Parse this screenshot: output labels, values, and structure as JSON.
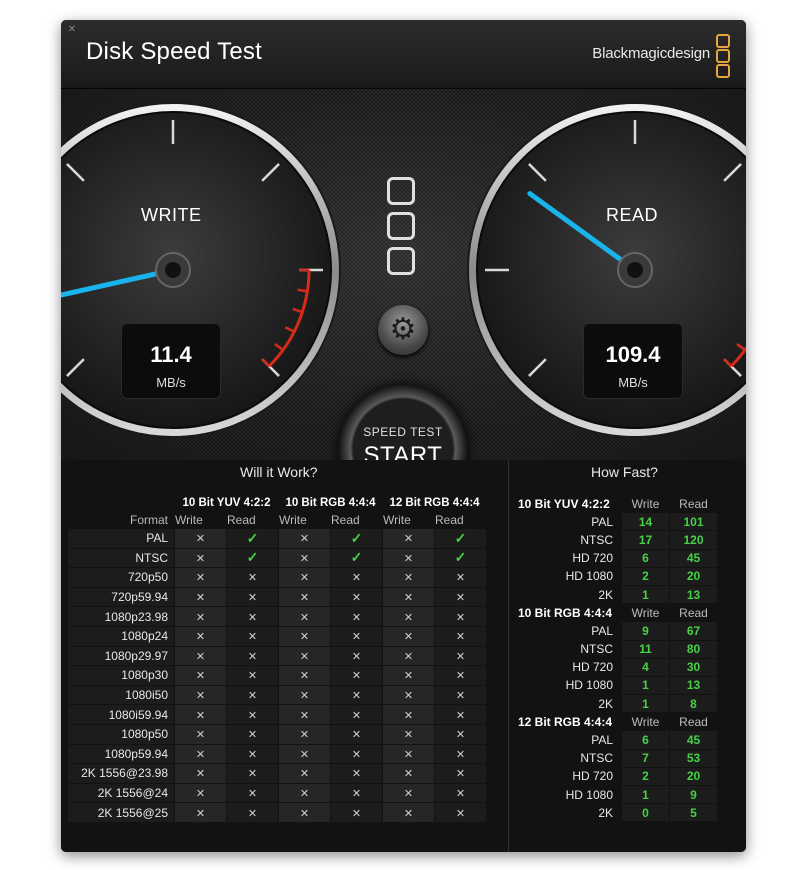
{
  "window": {
    "title": "Disk Speed Test",
    "brand": "Blackmagicdesign"
  },
  "gauges": {
    "write": {
      "label": "WRITE",
      "value": "11.4",
      "unit": "MB/s",
      "needle_fraction": 0.12
    },
    "read": {
      "label": "READ",
      "value": "109.4",
      "unit": "MB/s",
      "needle_fraction": 0.3
    }
  },
  "controls": {
    "start_small": "SPEED TEST",
    "start_big": "START",
    "settings_icon": "gear-icon"
  },
  "will_it_work": {
    "title": "Will it Work?",
    "format_header": "Format",
    "groups": [
      "10 Bit YUV 4:2:2",
      "10 Bit RGB 4:4:4",
      "12 Bit RGB 4:4:4"
    ],
    "subcols": [
      "Write",
      "Read"
    ],
    "rows": [
      {
        "format": "PAL",
        "cells": [
          "x",
          "ok",
          "x",
          "ok",
          "x",
          "ok"
        ]
      },
      {
        "format": "NTSC",
        "cells": [
          "x",
          "ok",
          "x",
          "ok",
          "x",
          "ok"
        ]
      },
      {
        "format": "720p50",
        "cells": [
          "x",
          "x",
          "x",
          "x",
          "x",
          "x"
        ]
      },
      {
        "format": "720p59.94",
        "cells": [
          "x",
          "x",
          "x",
          "x",
          "x",
          "x"
        ]
      },
      {
        "format": "1080p23.98",
        "cells": [
          "x",
          "x",
          "x",
          "x",
          "x",
          "x"
        ]
      },
      {
        "format": "1080p24",
        "cells": [
          "x",
          "x",
          "x",
          "x",
          "x",
          "x"
        ]
      },
      {
        "format": "1080p29.97",
        "cells": [
          "x",
          "x",
          "x",
          "x",
          "x",
          "x"
        ]
      },
      {
        "format": "1080p30",
        "cells": [
          "x",
          "x",
          "x",
          "x",
          "x",
          "x"
        ]
      },
      {
        "format": "1080i50",
        "cells": [
          "x",
          "x",
          "x",
          "x",
          "x",
          "x"
        ]
      },
      {
        "format": "1080i59.94",
        "cells": [
          "x",
          "x",
          "x",
          "x",
          "x",
          "x"
        ]
      },
      {
        "format": "1080p50",
        "cells": [
          "x",
          "x",
          "x",
          "x",
          "x",
          "x"
        ]
      },
      {
        "format": "1080p59.94",
        "cells": [
          "x",
          "x",
          "x",
          "x",
          "x",
          "x"
        ]
      },
      {
        "format": "2K 1556@23.98",
        "cells": [
          "x",
          "x",
          "x",
          "x",
          "x",
          "x"
        ]
      },
      {
        "format": "2K 1556@24",
        "cells": [
          "x",
          "x",
          "x",
          "x",
          "x",
          "x"
        ]
      },
      {
        "format": "2K 1556@25",
        "cells": [
          "x",
          "x",
          "x",
          "x",
          "x",
          "x"
        ]
      }
    ],
    "symbols": {
      "x": "✕",
      "ok": "✓"
    }
  },
  "how_fast": {
    "title": "How Fast?",
    "col_write": "Write",
    "col_read": "Read",
    "groups": [
      {
        "name": "10 Bit YUV 4:2:2",
        "rows": [
          {
            "label": "PAL",
            "write": "14",
            "read": "101"
          },
          {
            "label": "NTSC",
            "write": "17",
            "read": "120"
          },
          {
            "label": "HD 720",
            "write": "6",
            "read": "45"
          },
          {
            "label": "HD 1080",
            "write": "2",
            "read": "20"
          },
          {
            "label": "2K",
            "write": "1",
            "read": "13"
          }
        ]
      },
      {
        "name": "10 Bit RGB 4:4:4",
        "rows": [
          {
            "label": "PAL",
            "write": "9",
            "read": "67"
          },
          {
            "label": "NTSC",
            "write": "11",
            "read": "80"
          },
          {
            "label": "HD 720",
            "write": "4",
            "read": "30"
          },
          {
            "label": "HD 1080",
            "write": "1",
            "read": "13"
          },
          {
            "label": "2K",
            "write": "1",
            "read": "8"
          }
        ]
      },
      {
        "name": "12 Bit RGB 4:4:4",
        "rows": [
          {
            "label": "PAL",
            "write": "6",
            "read": "45"
          },
          {
            "label": "NTSC",
            "write": "7",
            "read": "53"
          },
          {
            "label": "HD 720",
            "write": "2",
            "read": "20"
          },
          {
            "label": "HD 1080",
            "write": "1",
            "read": "9"
          },
          {
            "label": "2K",
            "write": "0",
            "read": "5"
          }
        ]
      }
    ]
  }
}
